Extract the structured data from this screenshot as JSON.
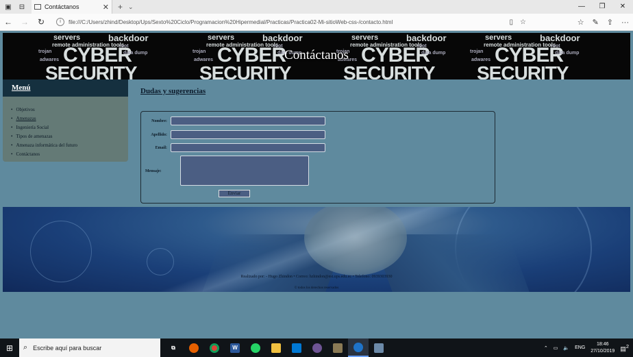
{
  "browser": {
    "tab_title": "Contáctanos",
    "url": "file:///C:/Users/zhind/Desktop/Ups/Sexto%20Ciclo/Programacion%20Hipermedial/Practicas/Practica02-Mi-sitioWeb-css-/contacto.html"
  },
  "banner": {
    "title": "Contáctanos",
    "cloud_words": [
      "servers",
      "backdoor",
      "remote administration tools",
      "CYBER",
      "SECURITY",
      "trojan",
      "data dump",
      "adwares",
      "root"
    ]
  },
  "menu": {
    "heading": "Menú",
    "items": [
      "Objetivos",
      "Amenazas",
      "Ingeniería Social",
      "Tipos de amenazas",
      "Amenaza informática del futuro",
      "Contáctanos"
    ]
  },
  "content": {
    "title": "Dudas y sugerencias"
  },
  "form": {
    "nombre_label": "Nombre:",
    "apellido_label": "Apellido:",
    "email_label": "Email:",
    "mensaje_label": "Mensaje:",
    "submit_label": "Enviar"
  },
  "footer": {
    "line": "Realizado por: - Hugo Zhindon • Correo: hzhindon@est.ups.edu.ec • Telefono: 0939303930",
    "copyright": "© todos los derechos reservados"
  },
  "taskbar": {
    "search_placeholder": "Escribe aquí para buscar",
    "language": "ENG",
    "time": "18:46",
    "date": "27/10/2019",
    "notifications": "2"
  },
  "colors": {
    "page_bg": "#5f8a9e",
    "menu_head": "#15303f",
    "menu_bg": "#647a76",
    "input_bg": "#4b5e83"
  }
}
